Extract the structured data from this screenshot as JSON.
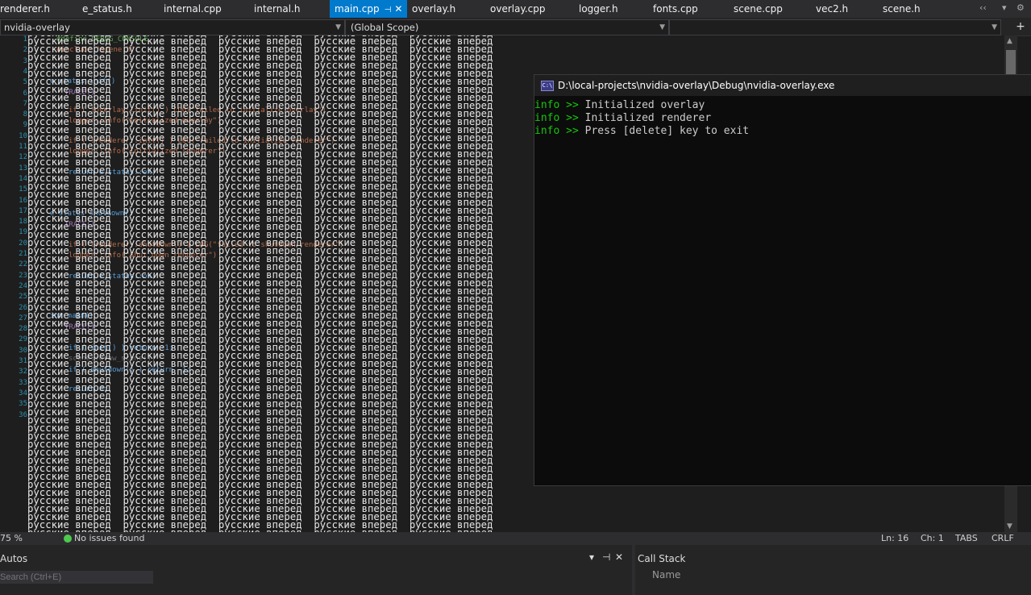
{
  "tabs": [
    {
      "label": "renderer.h",
      "active": false
    },
    {
      "label": "e_status.h",
      "active": false
    },
    {
      "label": "internal.cpp",
      "active": false
    },
    {
      "label": "internal.h",
      "active": false
    },
    {
      "label": "main.cpp",
      "active": true
    },
    {
      "label": "overlay.h",
      "active": false
    },
    {
      "label": "overlay.cpp",
      "active": false
    },
    {
      "label": "logger.h",
      "active": false
    },
    {
      "label": "fonts.cpp",
      "active": false
    },
    {
      "label": "scene.cpp",
      "active": false
    },
    {
      "label": "vec2.h",
      "active": false
    },
    {
      "label": "scene.h",
      "active": false
    }
  ],
  "tab_controls": {
    "overflow": "‹‹",
    "dropdown": "▾",
    "settings": "⚙",
    "pin": "⊣",
    "close": "✕"
  },
  "nav": {
    "project": "nvidia-overlay",
    "scope": "(Global Scope)",
    "add_icon": "+"
  },
  "line_numbers": [
    "1",
    "2",
    "3",
    "4",
    "5",
    "6",
    "7",
    "8",
    "9",
    "10",
    "11",
    "12",
    "13",
    "14",
    "15",
    "16",
    "17",
    "18",
    "19",
    "20",
    "21",
    "22",
    "23",
    "24",
    "25",
    "26",
    "27",
    "28",
    "29",
    "30",
    "31",
    "32",
    "33",
    "34",
    "35",
    "36"
  ],
  "code_fragments": [
    {
      "text": "#define DEBUG_CONSOLE",
      "cls": "cmt"
    },
    {
      "text": "#include \"scene.h\"",
      "cls": "str"
    },
    {
      "text": "e_status init()",
      "cls": "kw"
    },
    {
      "text": "TRACE()",
      "cls": "mac"
    },
    {
      "text": "if ( !overlay::init() ) LOG(\"failed to initialize overlay\")",
      "cls": "str"
    },
    {
      "text": "logger::info(\"Initialized overlay\")",
      "cls": "str"
    },
    {
      "text": "if ( !renderer::init() ) LOG(\"failed to initialize renderer\")",
      "cls": "str"
    },
    {
      "text": "logger::info(\"Initialized renderer\")",
      "cls": "str"
    },
    {
      "text": "return e_status::ok;",
      "cls": "kw"
    },
    {
      "text": "e_status shutdown()",
      "cls": "kw"
    },
    {
      "text": "TRACE()",
      "cls": "mac"
    },
    {
      "text": "if ( !renderer::shutdown() ) LOG(\"failed to shutdown renderer\")",
      "cls": "str"
    },
    {
      "text": "logger::info(\"Shut down renderer\")",
      "cls": "str"
    },
    {
      "text": "return e_status::ok;",
      "cls": "kw"
    },
    {
      "text": "int main()",
      "cls": "kw"
    },
    {
      "text": "TRACE()",
      "cls": "mac"
    },
    {
      "text": "if ( init() ) return -1;",
      "cls": "kw"
    },
    {
      "text": "scene::draw_scene();",
      "cls": ""
    },
    {
      "text": "if ( shutdown() ) return -1;",
      "cls": "kw"
    },
    {
      "text": "return 0;",
      "cls": "kw"
    }
  ],
  "overlay_text": {
    "word1": "русские",
    "word2": "вперед",
    "rows": 70,
    "cols": 5
  },
  "status": {
    "zoom": "75 %",
    "issues": "No issues found",
    "line": "Ln: 16",
    "col": "Ch: 1",
    "tabs": "TABS",
    "eol": "CRLF"
  },
  "panels": {
    "autos_title": "Autos",
    "search_placeholder": "Search (Ctrl+E)",
    "callstack_title": "Call Stack",
    "callstack_col": "Name",
    "controls": [
      "▾",
      "⊣",
      "✕"
    ]
  },
  "console": {
    "title": "D:\\local-projects\\nvidia-overlay\\Debug\\nvidia-overlay.exe",
    "icon": "C:\\",
    "lines": [
      {
        "tag": "info >>",
        "text": " Initialized overlay"
      },
      {
        "tag": "info >>",
        "text": " Initialized renderer"
      },
      {
        "tag": "info >>",
        "text": " Press [delete] key to exit"
      }
    ]
  },
  "colors": {
    "accent": "#007acc",
    "console_tag": "#16c60c",
    "editor_bg": "#1e1e1e"
  }
}
